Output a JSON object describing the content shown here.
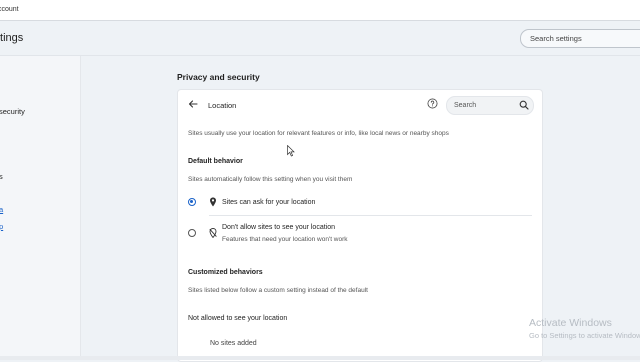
{
  "topbar": {
    "account_label": "ccount"
  },
  "header": {
    "title": "ttings",
    "search_placeholder": "Search settings"
  },
  "leftnav": {
    "items": [
      {
        "label": "security"
      },
      {
        "label": "s"
      }
    ],
    "links": [
      {
        "label": "a"
      },
      {
        "label": "p"
      }
    ]
  },
  "section": {
    "title": "Privacy and security"
  },
  "card": {
    "title": "Location",
    "search_placeholder": "Search",
    "description": "Sites usually use your location for relevant features or info, like local news or nearby shops",
    "default_behavior": {
      "heading": "Default behavior",
      "subtext": "Sites automatically follow this setting when you visit them",
      "options": [
        {
          "label": "Sites can ask for your location",
          "sublabel": "",
          "selected": true,
          "icon": "location-pin-icon"
        },
        {
          "label": "Don't allow sites to see your location",
          "sublabel": "Features that need your location won't work",
          "selected": false,
          "icon": "location-off-icon"
        }
      ]
    },
    "customized": {
      "heading": "Customized behaviors",
      "subtext": "Sites listed below follow a custom setting instead of the default",
      "not_allowed_heading": "Not allowed to see your location",
      "empty_text": "No sites added"
    }
  },
  "watermark": {
    "line1": "Activate Windows",
    "line2": "Go to Settings to activate Windows."
  },
  "colors": {
    "accent": "#1a62c9",
    "background": "#eef2f6",
    "card": "#ffffff"
  }
}
